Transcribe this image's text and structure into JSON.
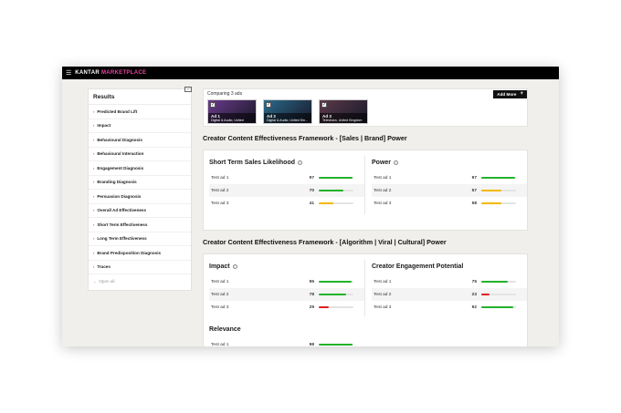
{
  "app": {
    "menu_icon": "hamburger-icon",
    "brand_main": "KANTAR",
    "brand_accent": "MARKETPLACE",
    "accent_color": "#e8459d"
  },
  "sidebar": {
    "title": "Results",
    "items": [
      {
        "label": "Predicted Brand Lift"
      },
      {
        "label": "Impact"
      },
      {
        "label": "Behavioural Diagnosis"
      },
      {
        "label": "Behavioural Interaction"
      },
      {
        "label": "Engagement Diagnosis"
      },
      {
        "label": "Branding Diagnosis"
      },
      {
        "label": "Persuasion Diagnosis"
      },
      {
        "label": "Overall Ad Effectiveness"
      },
      {
        "label": "Short Term Effectiveness"
      },
      {
        "label": "Long Term Effectiveness"
      },
      {
        "label": "Brand Predisposition Diagnosis"
      },
      {
        "label": "Traces"
      }
    ],
    "open_all": "Open all"
  },
  "compare": {
    "label": "Comparing 3 ads",
    "add_more": "Add More",
    "ads": [
      {
        "title": "Ad 1",
        "subtitle": "Digital & Audio, United",
        "bg": "#6a3a8a"
      },
      {
        "title": "Ad 2",
        "subtitle": "Digital & Audio, United Kin...",
        "bg": "#2a6a8a"
      },
      {
        "title": "Ad 3",
        "subtitle": "Television, United Kingdom",
        "bg": "#5a3a4a"
      }
    ]
  },
  "sections": [
    {
      "title": "Creator Content Effectiveness Framework - [Sales | Brand] Power",
      "metrics": [
        {
          "title": "Short Term Sales Likelihood",
          "info": true,
          "rows": [
            {
              "name": "Test ad 1",
              "value": 97,
              "color": "#22b22a"
            },
            {
              "name": "Test ad 2",
              "value": 70,
              "color": "#22b22a"
            },
            {
              "name": "Test ad 3",
              "value": 41,
              "color": "#f5b800"
            }
          ]
        },
        {
          "title": "Power",
          "info": true,
          "rows": [
            {
              "name": "Test ad 1",
              "value": 97,
              "color": "#22b22a"
            },
            {
              "name": "Test ad 2",
              "value": 57,
              "color": "#f5b800"
            },
            {
              "name": "Test ad 3",
              "value": 58,
              "color": "#f5b800"
            }
          ]
        }
      ]
    },
    {
      "title": "Creator Content Effectiveness Framework - [Algorithm | Viral | Cultural] Power",
      "metrics": [
        {
          "title": "Impact",
          "info": true,
          "rows": [
            {
              "name": "Test ad 1",
              "value": 95,
              "color": "#22b22a"
            },
            {
              "name": "Test ad 2",
              "value": 78,
              "color": "#22b22a"
            },
            {
              "name": "Test ad 3",
              "value": 29,
              "color": "#e02020"
            }
          ]
        },
        {
          "title": "Creator Engagement Potential",
          "info": false,
          "rows": [
            {
              "name": "Test ad 1",
              "value": 75,
              "color": "#22b22a"
            },
            {
              "name": "Test ad 2",
              "value": 23,
              "color": "#e02020"
            },
            {
              "name": "Test ad 3",
              "value": 92,
              "color": "#22b22a"
            }
          ]
        },
        {
          "title": "Relevance",
          "info": false,
          "rows": [
            {
              "name": "Test ad 1",
              "value": 98,
              "color": "#22b22a"
            }
          ]
        }
      ]
    }
  ]
}
